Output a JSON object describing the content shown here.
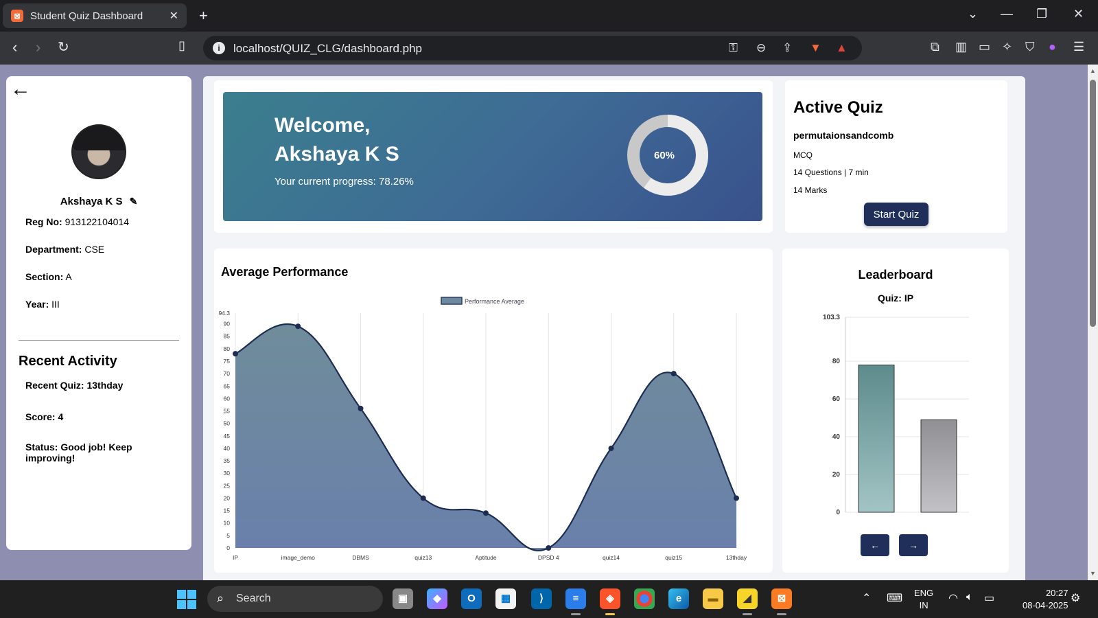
{
  "browser": {
    "tab_title": "Student Quiz Dashboard",
    "url": "localhost/QUIZ_CLG/dashboard.php"
  },
  "profile": {
    "name": "Akshaya K S",
    "reg_no_label": "Reg No:",
    "reg_no": "913122104014",
    "department_label": "Department:",
    "department": "CSE",
    "section_label": "Section:",
    "section": "A",
    "year_label": "Year:",
    "year": "III"
  },
  "recent_activity": {
    "title": "Recent Activity",
    "recent_quiz_label": "Recent Quiz:",
    "recent_quiz": "13thday",
    "score_label": "Score:",
    "score": "4",
    "status_label": "Status:",
    "status": "Good job! Keep improving!"
  },
  "welcome": {
    "line1": "Welcome,",
    "line2": "Akshaya K S",
    "progress_label": "Your current progress: 78.26%",
    "donut_label": "60%",
    "donut_fraction": 0.6
  },
  "active_quiz": {
    "title": "Active Quiz",
    "name": "permutaionsandcomb",
    "type": "MCQ",
    "details": "14 Questions | 7 min",
    "marks": "14 Marks",
    "button": "Start Quiz"
  },
  "performance": {
    "title": "Average Performance"
  },
  "leaderboard": {
    "title": "Leaderboard",
    "quiz_label": "Quiz: IP",
    "prev": "←",
    "next": "→"
  },
  "taskbar": {
    "search": "Search",
    "lang_line1": "ENG",
    "lang_line2": "IN",
    "time": "20:27",
    "date": "08-04-2025"
  },
  "colors": {
    "banner_start": "#3b7f8e",
    "banner_end": "#39518c",
    "button": "#1f2f5a",
    "page_bg": "#8d8eb0"
  },
  "chart_data": [
    {
      "type": "area",
      "title": "",
      "legend": [
        "Performance Average"
      ],
      "categories": [
        "IP",
        "image_demo",
        "DBMS",
        "quiz13",
        "Aptitude",
        "DPSD 4",
        "quiz14",
        "quiz15",
        "13thday"
      ],
      "series": [
        {
          "name": "Performance Average",
          "values": [
            78,
            89,
            56,
            20,
            14,
            0,
            40,
            70,
            20
          ]
        }
      ],
      "ylim": [
        0,
        94.3
      ],
      "yticks": [
        "0",
        "5",
        "10",
        "15",
        "20",
        "25",
        "30",
        "35",
        "40",
        "45",
        "50",
        "55",
        "60",
        "65",
        "70",
        "75",
        "80",
        "85",
        "90",
        "94.3"
      ]
    },
    {
      "type": "bar",
      "title": "Quiz: IP",
      "categories": [
        "",
        ""
      ],
      "values": [
        78,
        49
      ],
      "ylim": [
        0,
        103.3
      ],
      "yticks": [
        "0",
        "20",
        "40",
        "60",
        "80",
        "103.3"
      ]
    }
  ]
}
